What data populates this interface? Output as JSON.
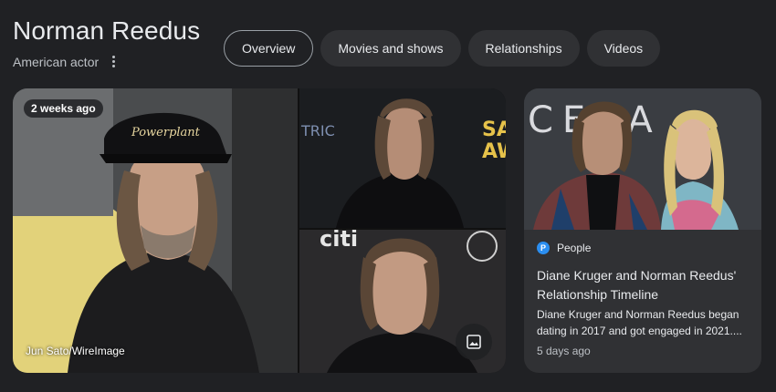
{
  "header": {
    "title": "Norman Reedus",
    "subtitle": "American actor"
  },
  "tabs": [
    {
      "label": "Overview",
      "active": true
    },
    {
      "label": "Movies and shows",
      "active": false
    },
    {
      "label": "Relationships",
      "active": false
    },
    {
      "label": "Videos",
      "active": false
    }
  ],
  "media": {
    "time_badge": "2 weeks ago",
    "credit": "Jun Sato/WireImage",
    "main_image_text": "Powerplant",
    "top_image_text_1": "TRIC",
    "top_image_text_2": "SA",
    "top_image_text_3": "AW",
    "bottom_image_text": "citi"
  },
  "news_card": {
    "source": "People",
    "source_icon_letter": "P",
    "headline": "Diane Kruger and Norman Reedus' Relationship Timeline",
    "snippet": "Diane Kruger and Norman Reedus began dating in 2017 and got engaged in 2021....",
    "time": "5 days ago",
    "image_text": "CERA"
  },
  "colors": {
    "background": "#202124",
    "chip": "#303134",
    "text": "#e8eaed",
    "secondary_text": "#bdc1c6",
    "people_blue": "#2b8ef0"
  }
}
